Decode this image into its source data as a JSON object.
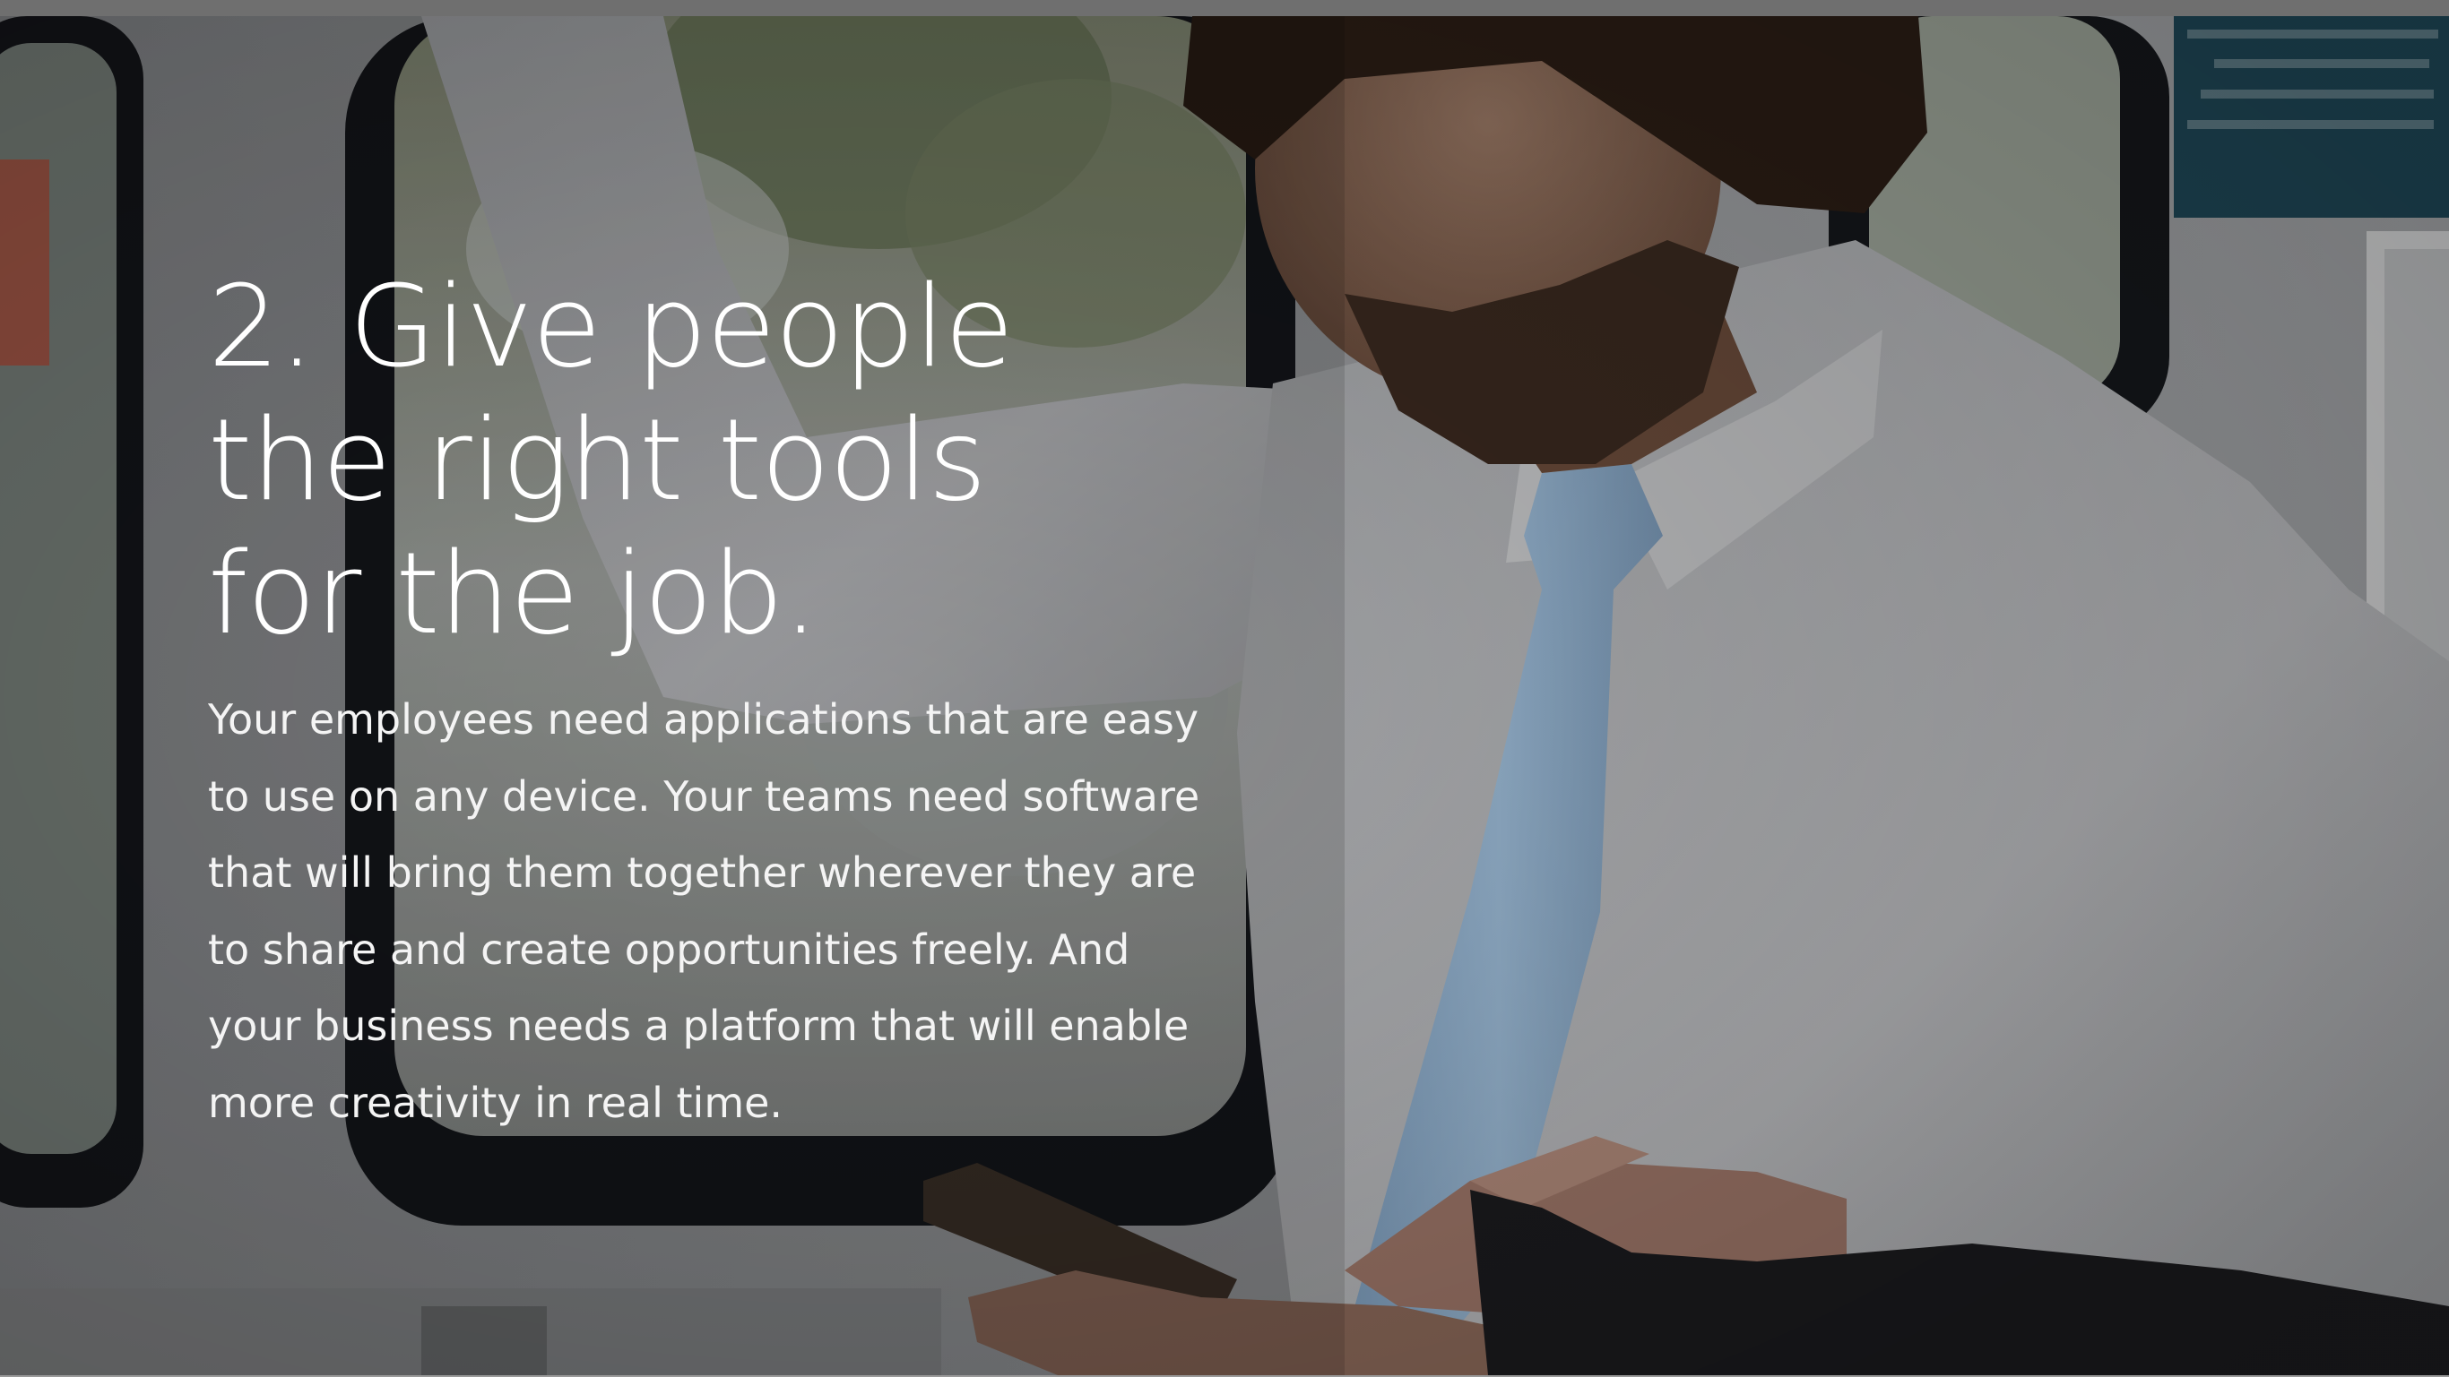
{
  "slide": {
    "headline_lines": [
      "2. Give people",
      "the right tools",
      "for the job."
    ],
    "body_lines": [
      "Your employees need applications that are easy",
      "to use on any device. Your teams need software",
      "that will bring them together wherever they are",
      "to share and create opportunities freely. And",
      "your business needs a platform that will enable",
      "more creativity in real time."
    ],
    "background_photo": "man-on-train-looking-at-phone",
    "colors": {
      "text": "#ffffff",
      "shirt": "#b7b8bb",
      "tie": "#8fb0cf",
      "window_frame": "#1b1d22"
    }
  }
}
